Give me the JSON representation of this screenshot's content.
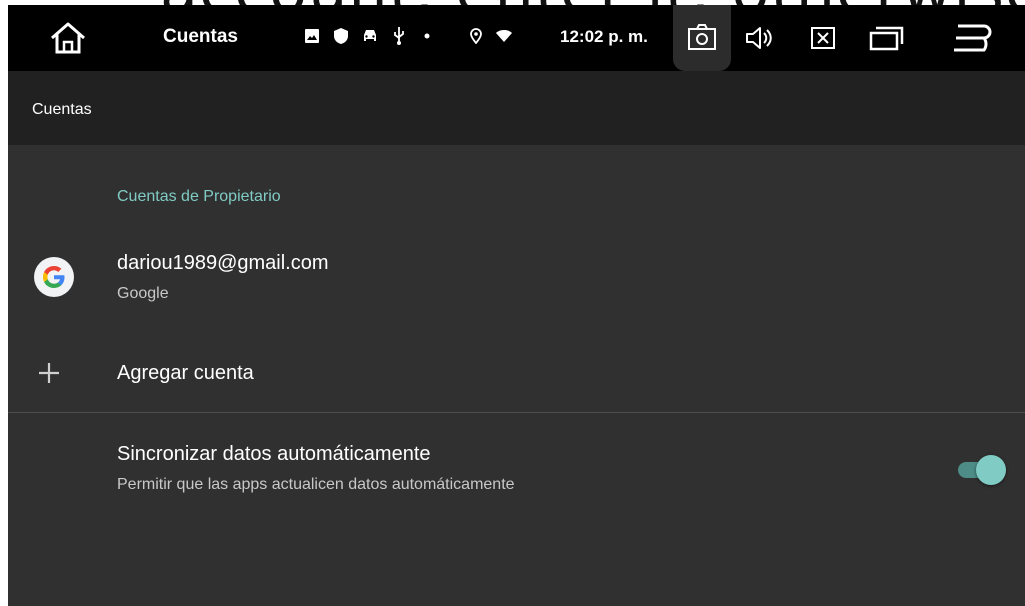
{
  "overlay": {
    "text": "account, enter it, otherwise"
  },
  "statusbar": {
    "title": "Cuentas",
    "time": "12:02 p. m.",
    "icons": [
      "image-icon",
      "shield-icon",
      "car-icon",
      "usb-icon",
      "dot-icon",
      "location-icon",
      "wifi-icon"
    ],
    "buttons": [
      "camera-icon",
      "volume-icon",
      "close-box-icon",
      "recent-apps-icon",
      "back-icon"
    ]
  },
  "appbar": {
    "title": "Cuentas"
  },
  "section": {
    "header": "Cuentas de Propietario"
  },
  "account": {
    "email": "dariou1989@gmail.com",
    "type": "Google"
  },
  "add_account": {
    "label": "Agregar cuenta"
  },
  "sync": {
    "title": "Sincronizar datos automáticamente",
    "subtitle": "Permitir que las apps actualicen datos automáticamente",
    "enabled": true
  },
  "colors": {
    "accent": "#80cbc4",
    "background": "#303030",
    "appbar": "#212121",
    "statusbar": "#000000"
  }
}
